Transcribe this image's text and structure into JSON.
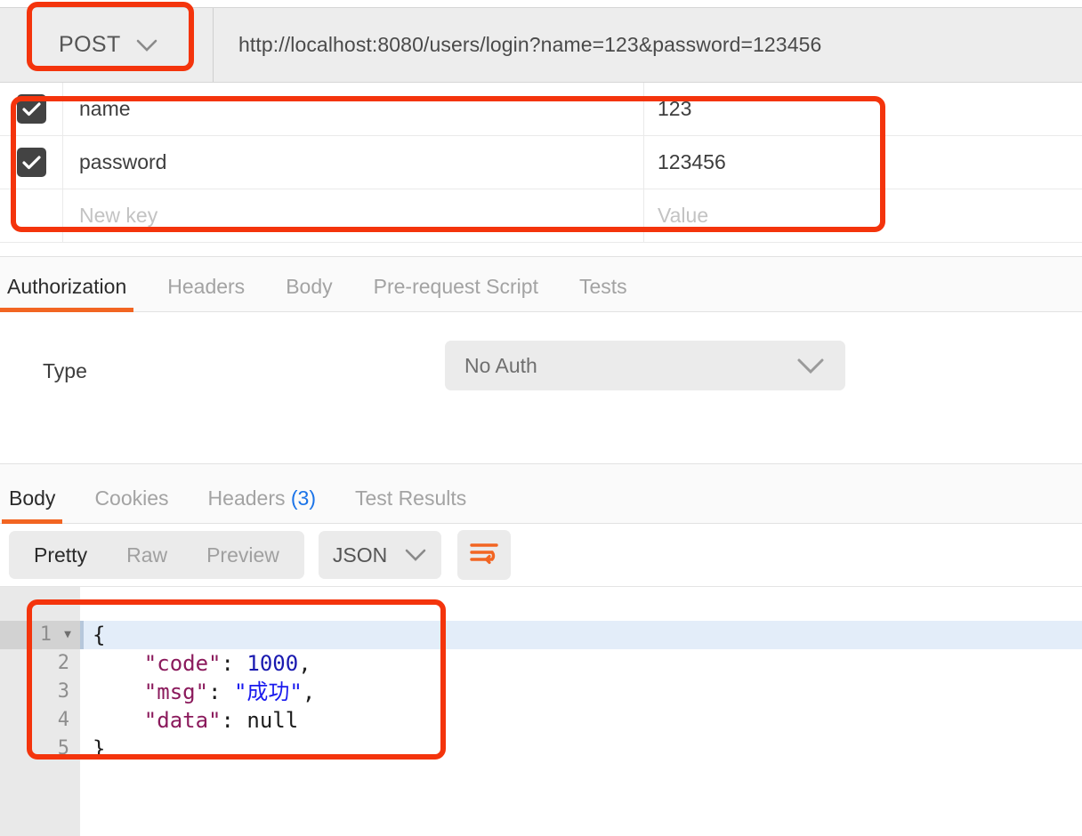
{
  "request": {
    "method": "POST",
    "url": "http://localhost:8080/users/login?name=123&password=123456",
    "params": {
      "rows": [
        {
          "checked": true,
          "key": "name",
          "value": "123"
        },
        {
          "checked": true,
          "key": "password",
          "value": "123456"
        }
      ],
      "new_row": {
        "key_placeholder": "New key",
        "value_placeholder": "Value"
      }
    },
    "tabs": [
      {
        "label": "Authorization",
        "active": true
      },
      {
        "label": "Headers",
        "active": false
      },
      {
        "label": "Body",
        "active": false
      },
      {
        "label": "Pre-request Script",
        "active": false
      },
      {
        "label": "Tests",
        "active": false
      }
    ],
    "auth": {
      "type_label": "Type",
      "selected": "No Auth"
    }
  },
  "response": {
    "tabs": [
      {
        "label": "Body",
        "active": true
      },
      {
        "label": "Cookies",
        "active": false
      },
      {
        "label": "Headers",
        "count": "(3)",
        "active": false
      },
      {
        "label": "Test Results",
        "active": false
      }
    ],
    "view_modes": [
      {
        "label": "Pretty",
        "active": true
      },
      {
        "label": "Raw",
        "active": false
      },
      {
        "label": "Preview",
        "active": false
      }
    ],
    "format": "JSON",
    "body": {
      "line_numbers": [
        "1",
        "2",
        "3",
        "4",
        "5"
      ],
      "lines": [
        {
          "n": "1",
          "open": "{"
        },
        {
          "n": "2",
          "indent": "    ",
          "key": "\"code\"",
          "sep": ": ",
          "value": "1000",
          "type": "number",
          "comma": ","
        },
        {
          "n": "3",
          "indent": "    ",
          "key": "\"msg\"",
          "sep": ": ",
          "value": "\"成功\"",
          "type": "string",
          "comma": ","
        },
        {
          "n": "4",
          "indent": "    ",
          "key": "\"data\"",
          "sep": ": ",
          "value": "null",
          "type": "null",
          "comma": ""
        },
        {
          "n": "5",
          "close": "}"
        }
      ]
    }
  },
  "colors": {
    "accent_orange": "#f26522",
    "annotation_red": "#f4340c",
    "json_key": "#8b1a5c",
    "json_number": "#1a1ab0",
    "json_string": "#1a1aee",
    "header_count_blue": "#1a73e8"
  }
}
